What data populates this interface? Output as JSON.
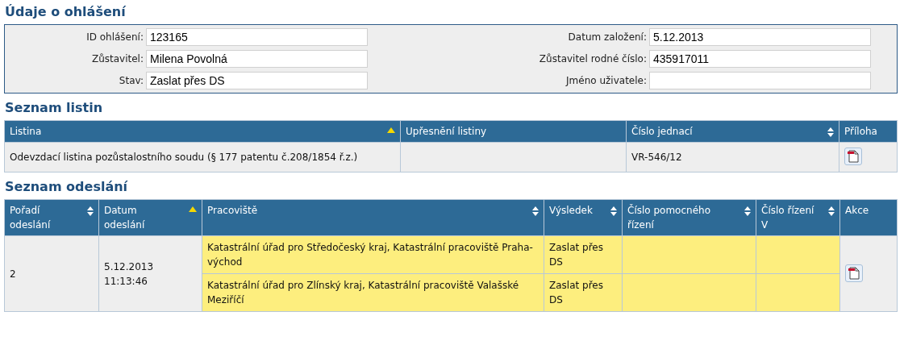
{
  "report_details": {
    "title": "Údaje o ohlášení",
    "left_fields": [
      {
        "label": "ID ohlášení:",
        "value": "123165"
      },
      {
        "label": "Zůstavitel:",
        "value": "Milena Povolná"
      },
      {
        "label": "Stav:",
        "value": "Zaslat přes DS"
      }
    ],
    "right_fields": [
      {
        "label": "Datum založení:",
        "value": "5.12.2013"
      },
      {
        "label": "Zůstavitel rodné číslo:",
        "value": "435917011"
      },
      {
        "label": "Jméno uživatele:"
      }
    ]
  },
  "documents": {
    "title": "Seznam listin",
    "columns": [
      {
        "label": "Listina",
        "sorted": true
      },
      {
        "label": "Upřesnění listiny",
        "sortable": false
      },
      {
        "label": "Číslo jednací",
        "sortable": true,
        "sorted": false
      },
      {
        "label": "Příloha",
        "sortable": false
      }
    ],
    "rows": [
      {
        "document": "Odevzdací listina pozůstalostního soudu (§ 177 patentu č.208/1854 ř.z.)",
        "reference_number": "VR-546/12",
        "attachment": true
      }
    ]
  },
  "dispatches": {
    "title": "Seznam odeslání",
    "columns": [
      {
        "label": "Pořadí odeslání",
        "sortable": true,
        "sorted": false
      },
      {
        "label": "Datum odeslání",
        "sorted": true
      },
      {
        "label": "Pracoviště",
        "sortable": true,
        "sorted": false
      },
      {
        "label": "Výsledek",
        "sortable": true,
        "sorted": false
      },
      {
        "label": "Číslo pomocného řízení",
        "sortable": true,
        "sorted": false
      },
      {
        "label": "Číslo řízení V",
        "sortable": true,
        "sorted": false
      },
      {
        "label": "Akce",
        "sortable": false
      }
    ],
    "rows": [
      {
        "order": "2",
        "date": "5.12.2013",
        "time": "11:13:46",
        "action": true,
        "destinations": [
          {
            "workplace": "Katastrální úřad pro Středočeský kraj, Katastrální pracoviště Praha-východ",
            "result": "Zaslat přes DS",
            "highlighted": true
          },
          {
            "workplace": "Katastrální úřad pro Zlínský kraj, Katastrální pracoviště Valašské Meziříčí",
            "result": "Zaslat přes DS",
            "highlighted": true
          }
        ]
      }
    ]
  }
}
